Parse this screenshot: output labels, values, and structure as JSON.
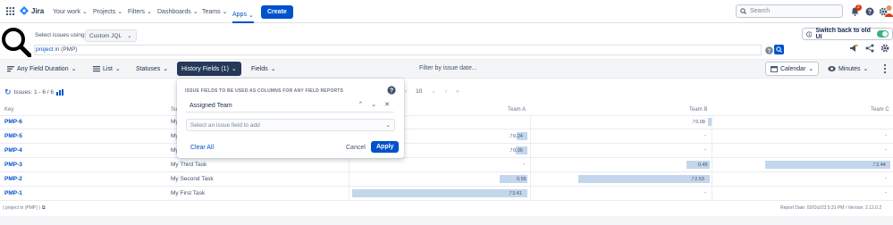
{
  "topnav": {
    "logo_text": "Jira",
    "items": [
      {
        "label": "Your work"
      },
      {
        "label": "Projects"
      },
      {
        "label": "Filters"
      },
      {
        "label": "Dashboards"
      },
      {
        "label": "Teams"
      },
      {
        "label": "Apps"
      }
    ],
    "create_label": "Create",
    "search_placeholder": "Search",
    "notification_count": "2"
  },
  "query": {
    "select_label": "Select issues using",
    "mode_value": "Custom JQL",
    "jql_keyword": "project",
    "jql_rest": " in (PMP)",
    "switch_label": "Switch back to old UI"
  },
  "toolbar": {
    "report_label": "Any Field Duration",
    "view_label": "List",
    "statuses_label": "Statuses",
    "history_label": "History Fields (1)",
    "fields_label": "Fields",
    "filter_placeholder": "Filter by issue date...",
    "calendar_label": "Calendar",
    "unit_label": "Minutes"
  },
  "table": {
    "issues_count": "Issues: 1 - 6 / 6",
    "page_size": "10",
    "headers": {
      "key": "Key",
      "summary": "Su",
      "team_a": "Team A",
      "team_b": "Team B",
      "team_c": "Team C"
    },
    "rows": [
      {
        "key": "PMP-6",
        "summary": "My",
        "a": "",
        "b": "0.09",
        "c": ""
      },
      {
        "key": "PMP-5",
        "summary": "My",
        "a": "0.24",
        "b": "-",
        "c": "-"
      },
      {
        "key": "PMP-4",
        "summary": "My",
        "a": "0.36",
        "b": "-",
        "c": "-"
      },
      {
        "key": "PMP-3",
        "summary": "My Third Task",
        "a": "-",
        "b": "0.45",
        "c": "2.44"
      },
      {
        "key": "PMP-2",
        "summary": "My Second Task",
        "a": "0.55",
        "b": "2.53",
        "c": "-"
      },
      {
        "key": "PMP-1",
        "summary": "My First Task",
        "a": "3.41",
        "b": "-",
        "c": "-"
      }
    ]
  },
  "popup": {
    "title": "ISSUE FIELDS TO BE USED AS COLUMNS FOR ANY FIELD REPORTS",
    "selected_field": "Assigned Team",
    "select_placeholder": "Select an issue field to add",
    "clear_label": "Clear All",
    "cancel_label": "Cancel",
    "apply_label": "Apply"
  },
  "footer": {
    "query_text": "( project in (PMP) )",
    "report_date": "Report Date: 02/Oct/23 5:31 PM / Version: 2.12.0.2"
  },
  "colors": {
    "accent": "#0052cc",
    "toolbar_dark": "#253858",
    "bar": "#c3d6ec",
    "danger": "#de350b",
    "success": "#36b37e"
  }
}
